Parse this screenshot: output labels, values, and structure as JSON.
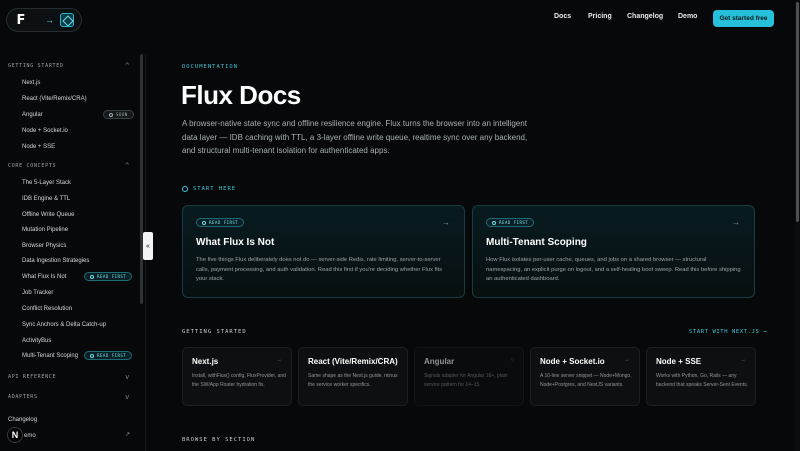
{
  "header": {
    "logo_mark": "F",
    "logo_arrow": "→",
    "nav": [
      "Docs",
      "Pricing",
      "Changelog",
      "Demo"
    ],
    "cta": "Get started free"
  },
  "sidebar": {
    "sections": [
      {
        "label": "GETTING STARTED",
        "chevron": "^"
      },
      {
        "label": "CORE CONCEPTS",
        "chevron": "^"
      },
      {
        "label": "API REFERENCE",
        "chevron": "v"
      },
      {
        "label": "ADAPTERS",
        "chevron": "v"
      }
    ],
    "getting_started": [
      "Next.js",
      "React (Vite/Remix/CRA)",
      "Angular",
      "Node + Socket.io",
      "Node + SSE"
    ],
    "angular_badge": "SOON",
    "core_concepts": [
      "The 5-Layer Stack",
      "IDB Engine & TTL",
      "Offline Write Queue",
      "Mutation Pipeline",
      "Browser Physics",
      "Data Ingestion Strategies",
      "What Flux Is Not",
      "Job Tracker",
      "Conflict Resolution",
      "Sync Anchors & Delta Catch-up",
      "ActivityBus",
      "Multi-Tenant Scoping"
    ],
    "read_first_badge": "READ FIRST",
    "bottom_links": [
      "Changelog",
      "emo"
    ],
    "avatar_letter": "N",
    "collapse_glyph": "«"
  },
  "main": {
    "eyebrow": "DOCUMENTATION",
    "title": "Flux Docs",
    "lede": "A browser-native state sync and offline resilience engine. Flux turns the browser into an intelligent data layer — IDB caching with TTL, a 3-layer offline write queue, realtime sync over any backend, and structural multi-tenant isolation for authenticated apps.",
    "start_here": "START HERE",
    "cards": [
      {
        "badge": "READ FIRST",
        "title": "What Flux Is Not",
        "desc": "The five things Flux deliberately does not do — server-side Redis, rate limiting, server-to-server calls, payment processing, and auth validation. Read this first if you're deciding whether Flux fits your stack.",
        "arrow": "→"
      },
      {
        "badge": "READ FIRST",
        "title": "Multi-Tenant Scoping",
        "desc": "How Flux isolates per-user cache, queues, and jobs on a shared browser — structural namespacing, an explicit purge on logout, and a self-healing boot sweep. Read this before shipping an authenticated dashboard.",
        "arrow": "→"
      }
    ],
    "getting_started_label": "GETTING STARTED",
    "getting_started_link": "START WITH NEXT.JS →",
    "mini_cards": [
      {
        "title": "Next.js",
        "desc": "Install, withFlux() config, FluxProvider, and the SW/App Router hydration fix.",
        "arrow": "→"
      },
      {
        "title": "React (Vite/Remix/CRA)",
        "desc": "Same shape as the Next.js guide, minus the service worker specifics.",
        "arrow": "→"
      },
      {
        "title": "Angular",
        "desc": "Signals adapter for Angular 16+, plain service pattern for 14–15.",
        "arrow": "○"
      },
      {
        "title": "Node + Socket.io",
        "desc": "A 10-line server snippet — Node+Mongo, Node+Postgres, and NestJS variants.",
        "arrow": "→"
      },
      {
        "title": "Node + SSE",
        "desc": "Works with Python, Go, Rails — any backend that speaks Server-Sent Events.",
        "arrow": "→"
      }
    ],
    "browse_label": "BROWSE BY SECTION"
  },
  "colors": {
    "accent": "#27c0da",
    "background": "#060809"
  }
}
